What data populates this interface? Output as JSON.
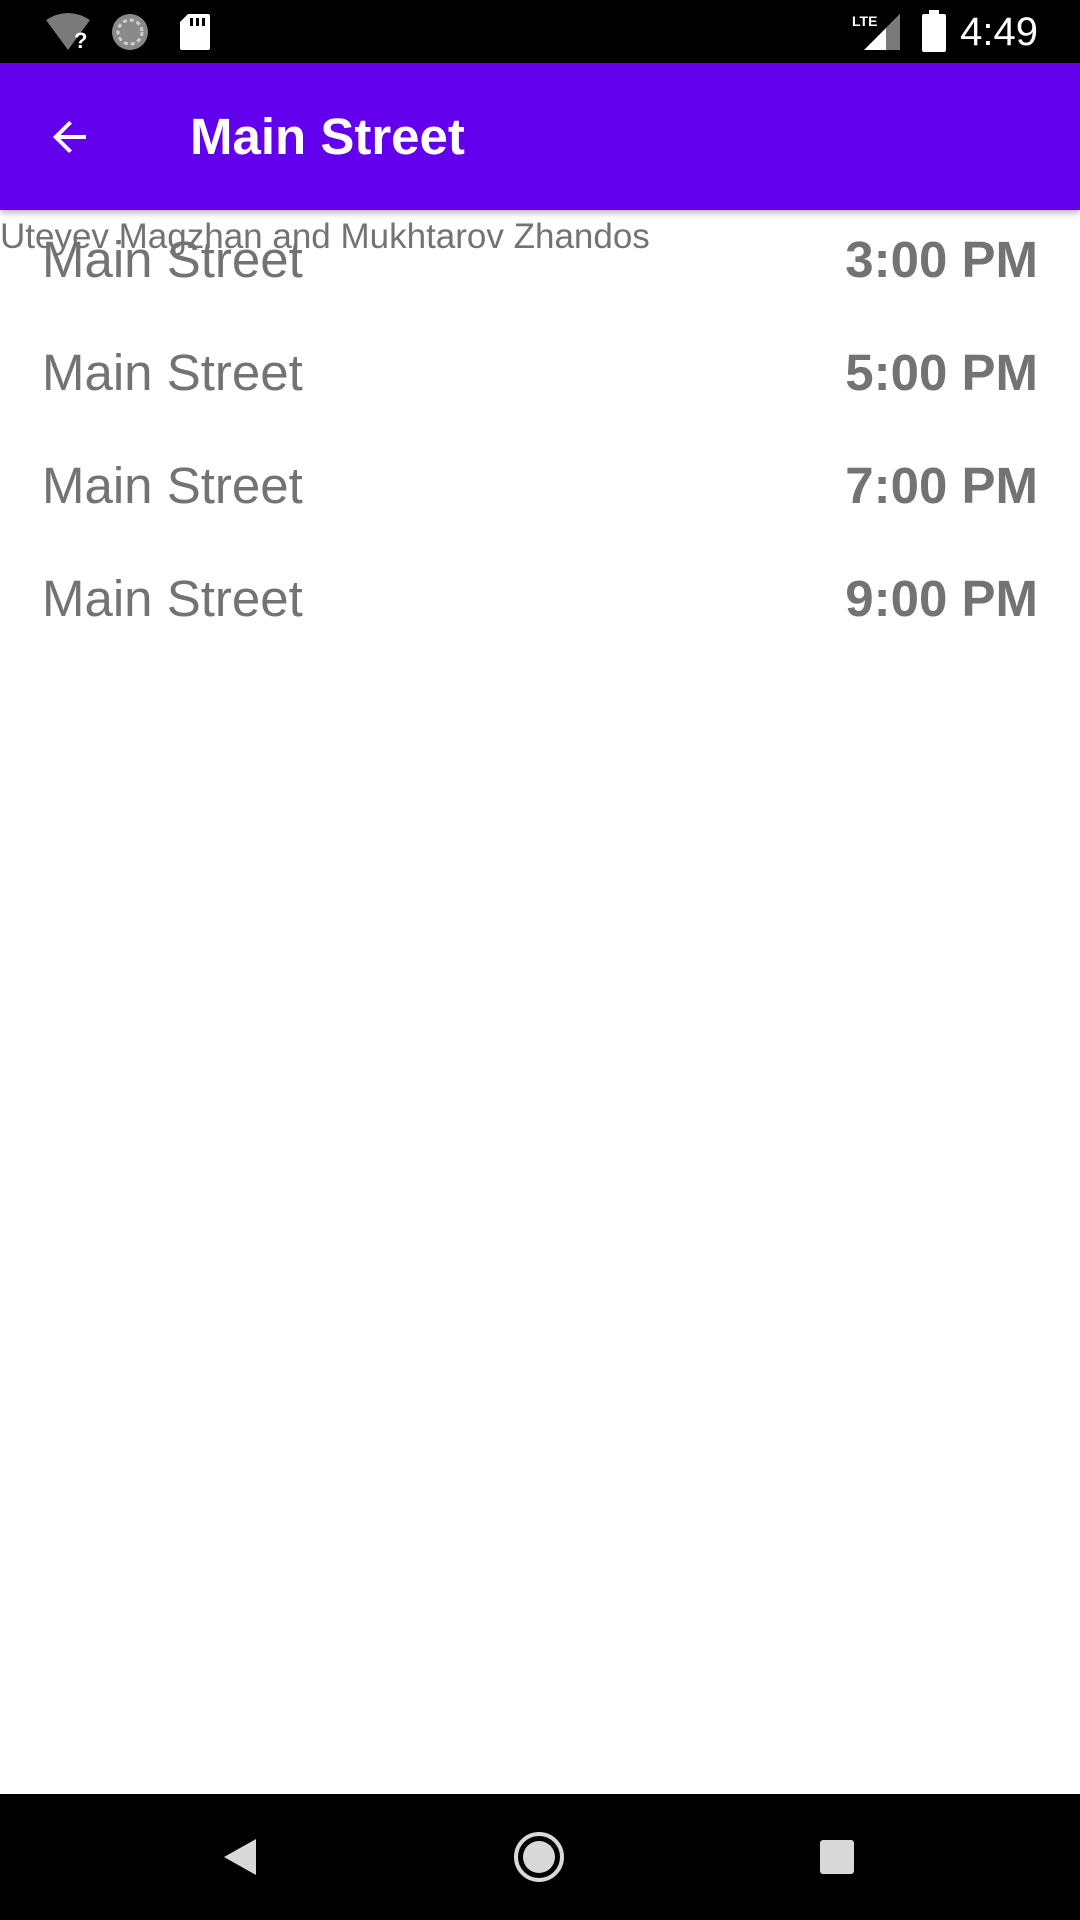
{
  "status_bar": {
    "time": "4:49",
    "icons": [
      "wifi-unknown-icon",
      "sync-icon",
      "sd-card-icon",
      "lte-signal-icon",
      "battery-icon"
    ],
    "lte_label": "LTE"
  },
  "app_bar": {
    "title": "Main Street",
    "back_icon": "arrow-back-icon",
    "color": "#6200ee"
  },
  "authors": "Uteyev Magzhan and Mukhtarov Zhandos",
  "schedule": [
    {
      "stop": "Main Street",
      "time": "3:00 PM"
    },
    {
      "stop": "Main Street",
      "time": "5:00 PM"
    },
    {
      "stop": "Main Street",
      "time": "7:00 PM"
    },
    {
      "stop": "Main Street",
      "time": "9:00 PM"
    }
  ],
  "nav_bar": {
    "icons": [
      "back-triangle-icon",
      "home-circle-icon",
      "recents-square-icon"
    ]
  }
}
